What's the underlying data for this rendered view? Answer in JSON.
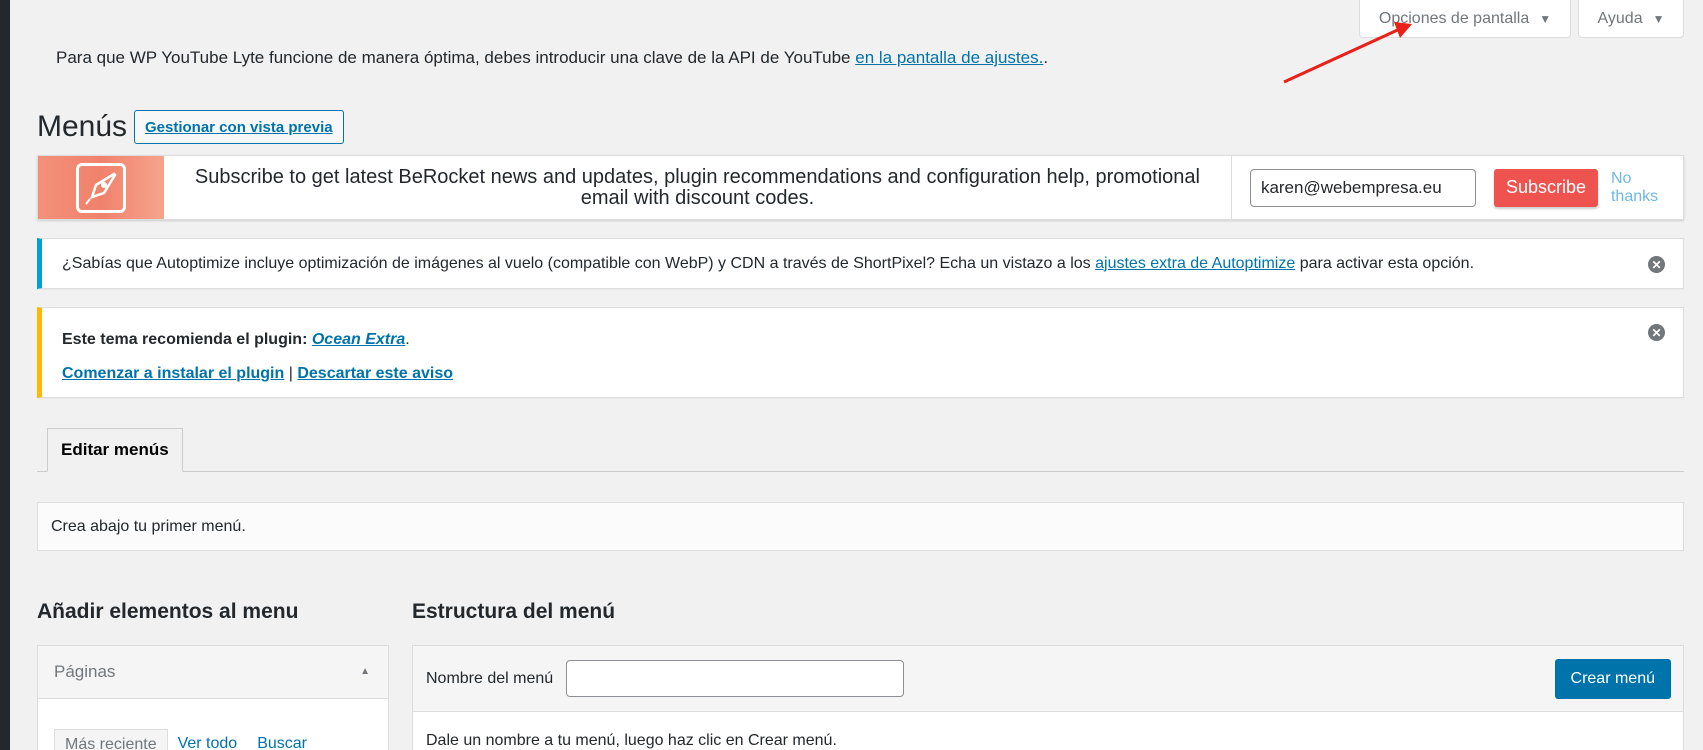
{
  "screen_meta": {
    "screen_options_label": "Opciones de pantalla",
    "help_label": "Ayuda"
  },
  "lyte_notice": {
    "text": "Para que WP YouTube Lyte funcione de manera óptima, debes introducir una clave de la API de YouTube",
    "link": "en la pantalla de ajustes.",
    "suffix": "."
  },
  "header": {
    "title": "Menús",
    "action_label": "Gestionar con vista previa"
  },
  "berocket": {
    "text": "Subscribe to get latest BeRocket news and updates, plugin recommendations and configuration help, promotional email with discount codes.",
    "email_value": "karen@webempresa.eu",
    "subscribe_label": "Subscribe",
    "no_thanks_label": "No thanks"
  },
  "autoptimize_notice": {
    "text": "¿Sabías que Autoptimize incluye optimización de imágenes al vuelo (compatible con WebP) y CDN a través de ShortPixel? Echa un vistazo a los",
    "link": "ajustes extra de Autoptimize",
    "suffix": "para activar esta opción."
  },
  "theme_notice": {
    "prefix": "Este tema recomienda el plugin:",
    "plugin_link": "Ocean Extra",
    "period": ".",
    "install_link": "Comenzar a instalar el plugin",
    "separator": "|",
    "dismiss_link": "Descartar este aviso"
  },
  "tabs": {
    "active": "Editar menús"
  },
  "create_notice": "Crea abajo tu primer menú.",
  "add_items": {
    "title": "Añadir elementos al menu",
    "pages_label": "Páginas",
    "tab_recent": "Más reciente",
    "tab_all": "Ver todo",
    "tab_search": "Buscar"
  },
  "structure": {
    "title": "Estructura del menú",
    "name_label": "Nombre del menú",
    "name_value": "",
    "create_label": "Crear menú",
    "hint": "Dale un nombre a tu menú, luego haz clic en Crear menú."
  },
  "colors": {
    "accent": "#0073aa",
    "subscribe": "#ef5350",
    "info_border": "#00a0d2",
    "warning_border": "#ffb900",
    "annotation_arrow": "#e8211a"
  }
}
